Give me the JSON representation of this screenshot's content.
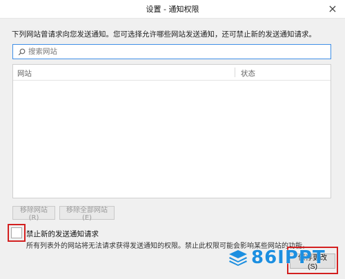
{
  "window": {
    "title": "设置 - 通知权限",
    "close_glyph": "×"
  },
  "description": "下列网站曾请求向您发送通知。您可选择允许哪些网站发送通知，还可禁止新的发送通知请求。",
  "search": {
    "placeholder": "搜索网站",
    "value": ""
  },
  "table": {
    "columns": [
      "网站",
      "状态"
    ],
    "rows": []
  },
  "buttons": {
    "remove_site": "移除网站(R)",
    "remove_all_sites": "移除全部网站(E)",
    "save_changes": "保存更改(S)"
  },
  "block_new_requests": {
    "label": "禁止新的发送通知请求",
    "checked": false,
    "note": "所有列表外的网站将无法请求获得发送通知的权限。禁止此权限可能会影响某些网站的功能。"
  },
  "watermark": {
    "text": "86IPPT",
    "color": "#1d8fe0"
  },
  "colors": {
    "highlight": "#d31f1f",
    "focus": "#3f8ee6"
  }
}
